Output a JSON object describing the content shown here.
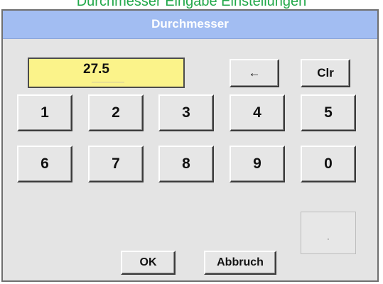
{
  "background_title": "Durchmesser Eingabe Einstellungen",
  "dialog": {
    "title": "Durchmesser",
    "value": "27.5"
  },
  "keys": {
    "backspace": "←",
    "clear": "Clr",
    "digits_row1": [
      "1",
      "2",
      "3",
      "4",
      "5"
    ],
    "digits_row2": [
      "6",
      "7",
      "8",
      "9",
      "0"
    ],
    "decimal": "."
  },
  "actions": {
    "ok": "OK",
    "cancel": "Abbruch"
  },
  "colors": {
    "title_bar": "#a2bdf2",
    "display_bg": "#fbf38a",
    "dialog_bg": "#e4e4e4",
    "background_text": "#22a84a"
  }
}
